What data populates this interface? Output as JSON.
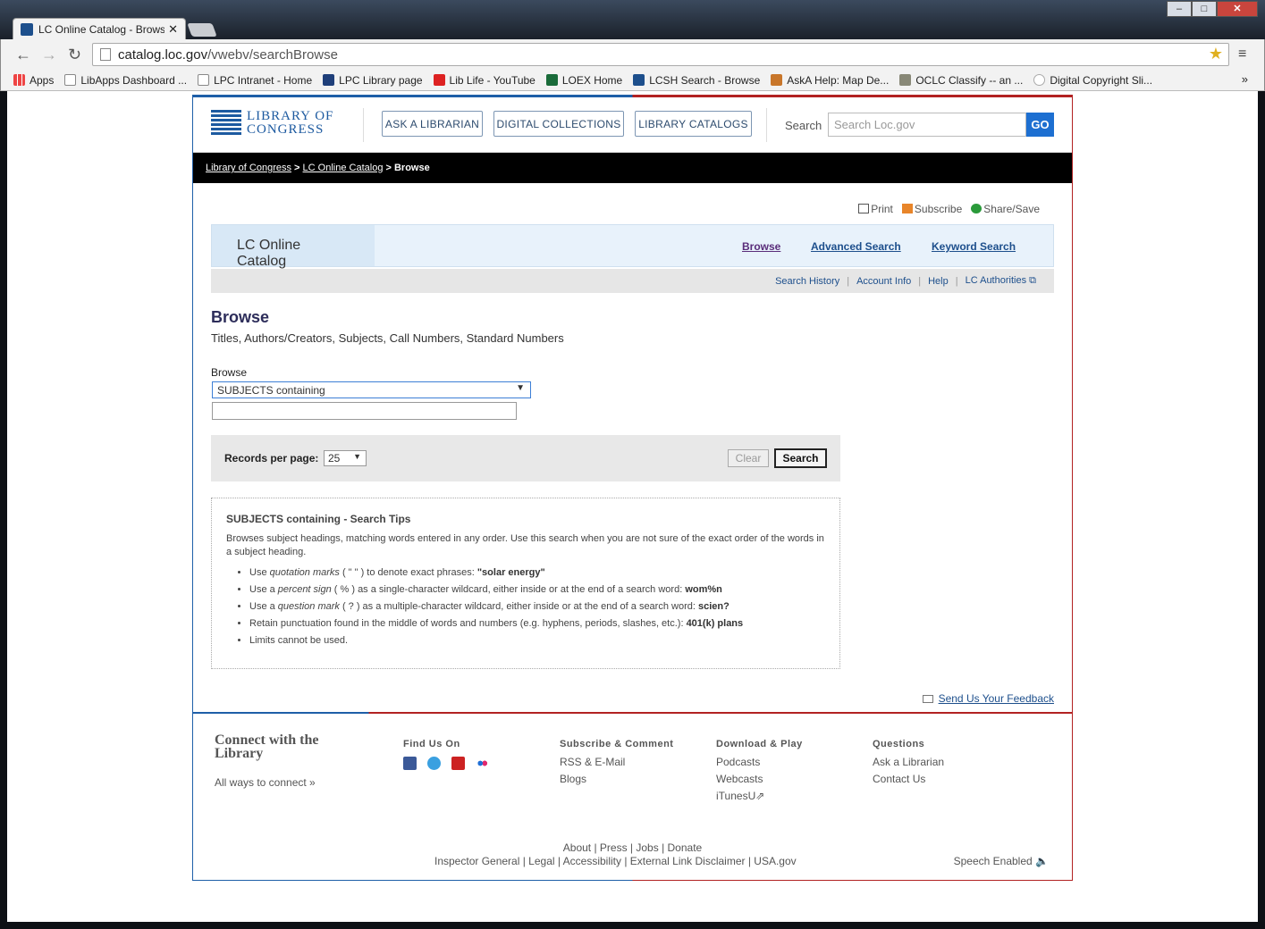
{
  "browser": {
    "tab_title": "LC Online Catalog - Brows",
    "url_domain": "catalog.loc.gov",
    "url_path": "/vwebv/searchBrowse",
    "bookmarks": [
      "Apps",
      "LibApps Dashboard ...",
      "LPC Intranet - Home",
      "LPC Library page",
      "Lib Life - YouTube",
      "LOEX Home",
      "LCSH Search - Browse",
      "AskA Help: Map De...",
      "OCLC Classify -- an ...",
      "Digital Copyright Sli..."
    ],
    "bookmarks_more": "»"
  },
  "header": {
    "logo_line1": "LIBRARY OF",
    "logo_line2": "CONGRESS",
    "btn_ask": "ASK A LIBRARIAN",
    "btn_digital": "DIGITAL COLLECTIONS",
    "btn_catalogs": "LIBRARY CATALOGS",
    "search_label": "Search",
    "search_placeholder": "Search Loc.gov",
    "go": "GO"
  },
  "breadcrumb": {
    "item1": "Library of Congress",
    "sep": " > ",
    "item2": "LC Online Catalog",
    "current": "Browse"
  },
  "utility": {
    "print": "Print",
    "subscribe": "Subscribe",
    "share": "Share/Save"
  },
  "catalog": {
    "name": "LC Online Catalog",
    "browse": "Browse",
    "advanced": "Advanced Search",
    "keyword": "Keyword Search"
  },
  "subnav": {
    "history": "Search History",
    "account": "Account Info",
    "help": "Help",
    "authorities": "LC Authorities"
  },
  "main": {
    "title": "Browse",
    "subtitle": "Titles, Authors/Creators, Subjects, Call Numbers, Standard Numbers",
    "browse_label": "Browse",
    "browse_value": "SUBJECTS containing",
    "records_label": "Records per page:",
    "records_value": "25",
    "clear": "Clear",
    "search": "Search"
  },
  "tips": {
    "title": "SUBJECTS containing - Search Tips",
    "desc": "Browses subject headings, matching words entered in any order. Use this search when you are not sure of the exact order of the words in a subject heading.",
    "items": [
      {
        "pre": "Use ",
        "em": "quotation marks",
        "mid": " ( \" \" ) to denote exact phrases: ",
        "ex": "\"solar energy\""
      },
      {
        "pre": "Use a ",
        "em": "percent sign",
        "mid": " ( % ) as a single-character wildcard, either inside or at the end of a search word: ",
        "ex": "wom%n"
      },
      {
        "pre": "Use a ",
        "em": "question mark",
        "mid": " ( ? ) as a multiple-character wildcard, either inside or at the end of a search word: ",
        "ex": "scien?"
      },
      {
        "pre": "Retain punctuation found in the middle of words and numbers (e.g. hyphens, periods, slashes, etc.): ",
        "em": "",
        "mid": "",
        "ex": "401(k) plans"
      },
      {
        "pre": "Limits cannot be used.",
        "em": "",
        "mid": "",
        "ex": ""
      }
    ]
  },
  "feedback": "Send Us Your Feedback",
  "footer": {
    "connect": "Connect with the Library",
    "all_ways": "All ways to connect »",
    "find_us": "Find Us On",
    "subscribe_h": "Subscribe & Comment",
    "rss": "RSS & E-Mail",
    "blogs": "Blogs",
    "download_h": "Download & Play",
    "podcasts": "Podcasts",
    "webcasts": "Webcasts",
    "itunes": "iTunesU",
    "questions_h": "Questions",
    "ask": "Ask a Librarian",
    "contact": "Contact Us",
    "links1": "About | Press | Jobs | Donate",
    "links2": "Inspector General | Legal | Accessibility | External Link Disclaimer | USA.gov",
    "speech": "Speech Enabled"
  }
}
